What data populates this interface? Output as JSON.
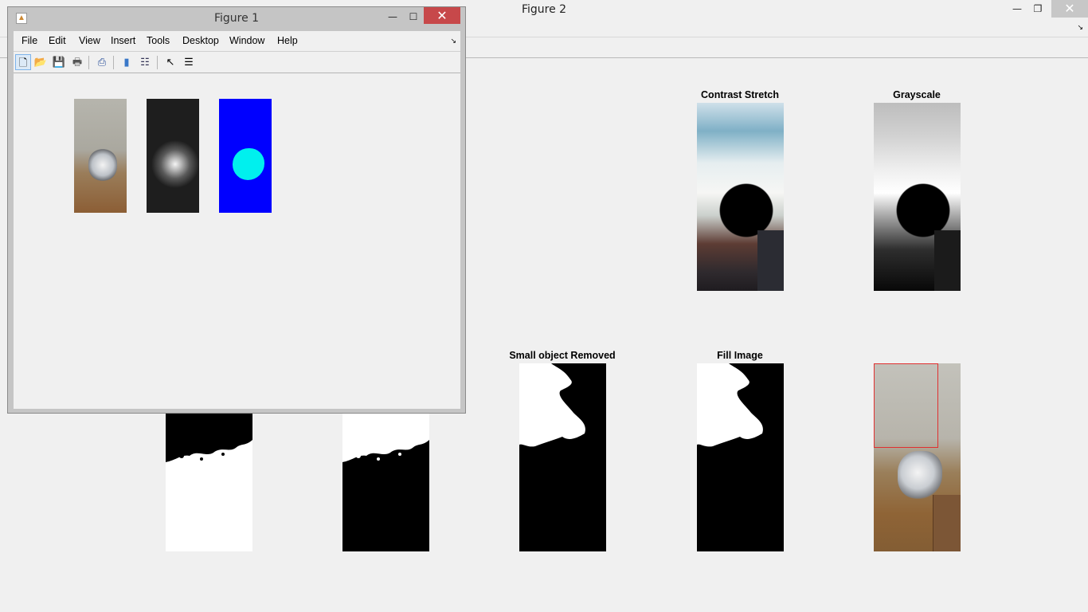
{
  "figure2": {
    "title": "Figure 2",
    "window_controls": {
      "minimize": "—",
      "restore": "❐",
      "close": "✕"
    },
    "menu_arrow": "↘",
    "axes": {
      "contrast": {
        "title": "Contrast Stretch"
      },
      "grayscale": {
        "title": "Grayscale"
      },
      "small_object": {
        "title": "Small object Removed"
      },
      "fill": {
        "title": "Fill Image"
      }
    }
  },
  "figure1": {
    "title": "Figure 1",
    "window_controls": {
      "minimize": "—",
      "maximize": "☐",
      "close": "✕"
    },
    "menu": [
      "File",
      "Edit",
      "View",
      "Insert",
      "Tools",
      "Desktop",
      "Window",
      "Help"
    ],
    "menu_arrow": "↘",
    "toolbar": {
      "new": "🗋",
      "open": "📂",
      "save": "💾",
      "print": "🖶",
      "link": "⎙",
      "colorbar": "▮",
      "legend": "☷",
      "pointer": "↖",
      "property_editor": "☰"
    },
    "images": [
      {
        "name": "original",
        "color": "#9a7d5a"
      },
      {
        "name": "heatmap",
        "color": "#1e1e1e"
      },
      {
        "name": "segmented",
        "color": "#0000ff",
        "accent": "#00f0ee"
      }
    ]
  }
}
